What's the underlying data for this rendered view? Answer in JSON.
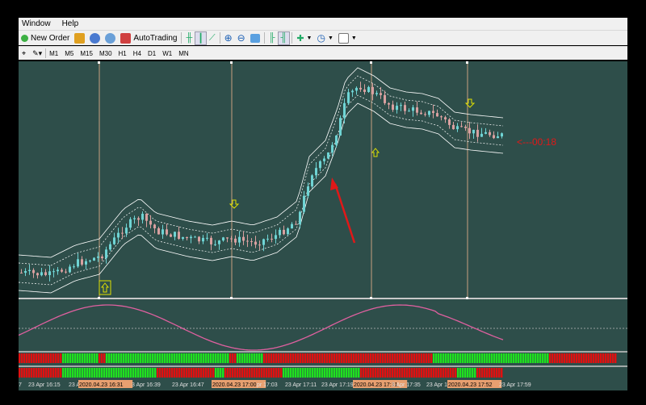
{
  "menu": {
    "items": [
      "Window",
      "Help"
    ]
  },
  "toolbar": {
    "new_order": "New Order",
    "autotrading": "AutoTrading"
  },
  "timeframes": [
    "M1",
    "M5",
    "M15",
    "M30",
    "H1",
    "H4",
    "D1",
    "W1",
    "MN"
  ],
  "chart": {
    "timer_label": "<---00:18",
    "time_axis": [
      "7",
      "23 Apr 16:15",
      "23 Ap",
      "2020.04.23 16:31",
      "3 Apr 16:39",
      "23 Apr 16:47",
      "2020.04.23 17:00",
      "pr 17:03",
      "23 Apr 17:11",
      "23 Apr 17:19",
      "2020.04.23 17:31",
      "3 Apr 17:35",
      "23 Apr 17:43",
      "2020.04.23 17:52",
      "23 Apr 17:59"
    ],
    "highlighted_times": [
      "2020.04.23 16:31",
      "2020.04.23 17:00",
      "2020.04.23 17:31",
      "2020.04.23 17:52"
    ]
  },
  "colors": {
    "background": "#2e4e4a",
    "bull_candle": "#6fd4d4",
    "bear_candle": "#d9a0a0",
    "band": "#ffffff",
    "oscillator": "#e060a0",
    "bar_red": "#e01010",
    "bar_green": "#20e020",
    "arrow_yellow": "#e0e000",
    "annotation_red": "#e01818"
  }
}
